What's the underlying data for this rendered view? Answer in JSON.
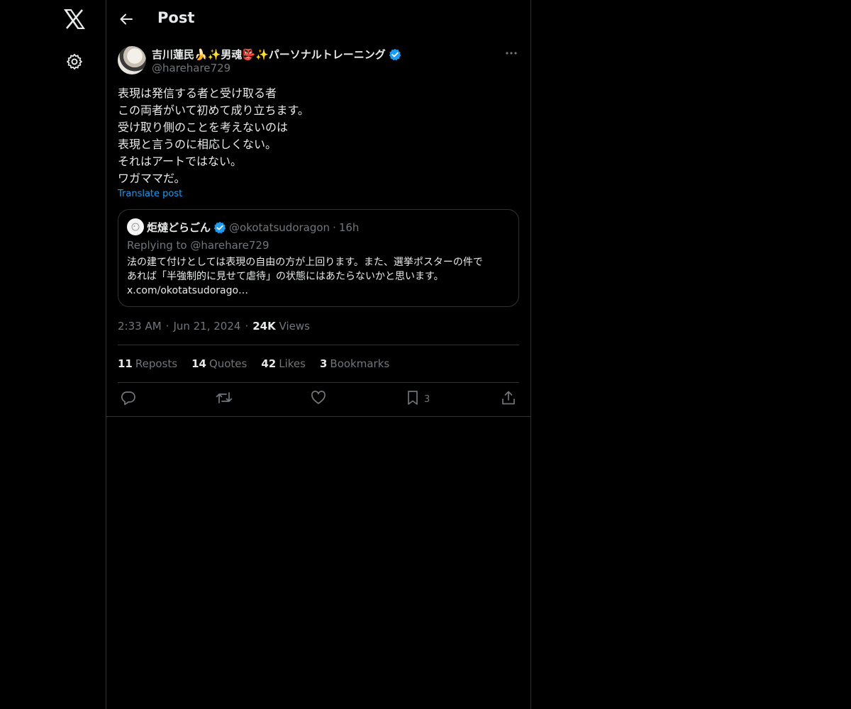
{
  "header": {
    "title": "Post"
  },
  "author": {
    "name": "吉川蓮民🍌✨男魂👺✨パーソナルトレーニング",
    "handle": "@harehare729"
  },
  "post": {
    "lines": [
      "表現は発信する者と受け取る者",
      "この両者がいて初めて成り立ちます。",
      "受け取り側のことを考えないのは",
      "表現と言うのに相応しくない。",
      "それはアートではない。",
      "ワガママだ。"
    ],
    "translate_label": "Translate post"
  },
  "quote": {
    "name": "炬燵どらごん",
    "handle": "@okotatsudoragon",
    "dot": "·",
    "time": "16h",
    "replying": "Replying to @harehare729",
    "body_lines": [
      "法の建て付けとしては表現の自由の方が上回ります。また、選挙ポスターの件で",
      "あれば「半強制的に見せて虐待」の状態にはあたらないかと思います。",
      "x.com/okotatsudorago…"
    ]
  },
  "meta": {
    "time": "2:33 AM",
    "dot1": "·",
    "date": "Jun 21, 2024",
    "dot2": "·",
    "views_count": "24K",
    "views_label": "Views"
  },
  "stats": {
    "reposts_count": "11",
    "reposts_label": "Reposts",
    "quotes_count": "14",
    "quotes_label": "Quotes",
    "likes_count": "42",
    "likes_label": "Likes",
    "bookmarks_count": "3",
    "bookmarks_label": "Bookmarks"
  },
  "actions": {
    "bookmark_count": "3"
  },
  "colors": {
    "accent": "#1d9bf0",
    "background": "#000000",
    "text": "#e7e9ea",
    "muted": "#71767b",
    "border": "#2f3336"
  }
}
